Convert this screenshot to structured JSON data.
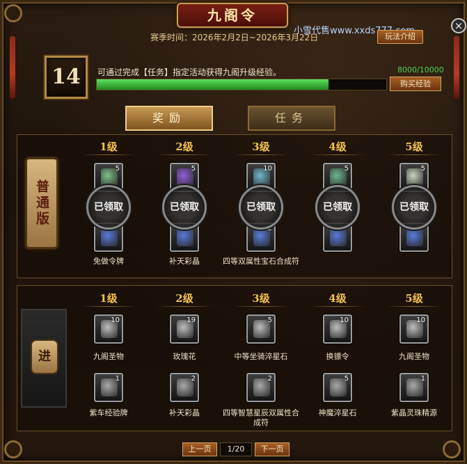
{
  "header": {
    "title": "九阁令",
    "season": "赛季时间：2026年2月2日~2026年3月22日",
    "watermark": "小雪代售www.xxds777.com",
    "rules_label": "玩法介绍",
    "close_label": "×"
  },
  "progress": {
    "level": "14",
    "description": "可通过完成【任务】指定活动获得九阁升级经验。",
    "text": "8000/10000",
    "fraction": 0.8,
    "buy_label": "购买经验"
  },
  "tabs": [
    {
      "label": "奖励",
      "active": true
    },
    {
      "label": "任务",
      "active": false
    }
  ],
  "normal_track": {
    "badge": "普通版",
    "claimed_label": "已领取",
    "levels": [
      {
        "level": "1级",
        "top_qty": "5",
        "bottom_name": "免做令牌"
      },
      {
        "level": "2级",
        "top_qty": "5",
        "bottom_name": "补天彩晶"
      },
      {
        "level": "3级",
        "top_qty": "10",
        "bottom_qty": "2",
        "bottom_name": "四等双属性宝石合成符"
      },
      {
        "level": "4级",
        "top_qty": "5"
      },
      {
        "level": "5级",
        "top_qty": "5"
      }
    ]
  },
  "advanced_track": {
    "badge": "进",
    "levels": [
      {
        "level": "1级",
        "top_qty": "10",
        "top_name": "九阁圣物",
        "bottom_qty": "1",
        "bottom_name": "紫车经验牌"
      },
      {
        "level": "2级",
        "top_qty": "19",
        "top_name": "玫瑰花",
        "bottom_qty": "2",
        "bottom_name": "补天彩晶"
      },
      {
        "level": "3级",
        "top_qty": "5",
        "top_name": "中等坐骑淬星石",
        "bottom_qty": "2",
        "bottom_name": "四等智慧星辰双属性合成符"
      },
      {
        "level": "4级",
        "top_qty": "10",
        "top_name": "换镖令",
        "bottom_qty": "5",
        "bottom_name": "神魔淬星石"
      },
      {
        "level": "5级",
        "top_qty": "10",
        "top_name": "九阁圣物",
        "bottom_qty": "1",
        "bottom_name": "紫晶灵珠精源"
      }
    ]
  },
  "pager": {
    "prev_label": "上一页",
    "page": "1/20",
    "next_label": "下一页"
  },
  "colors": {
    "accent_gold": "#f2c24e",
    "progress_green": "#3ec23e",
    "button_bronze": "#8a4a1a"
  }
}
